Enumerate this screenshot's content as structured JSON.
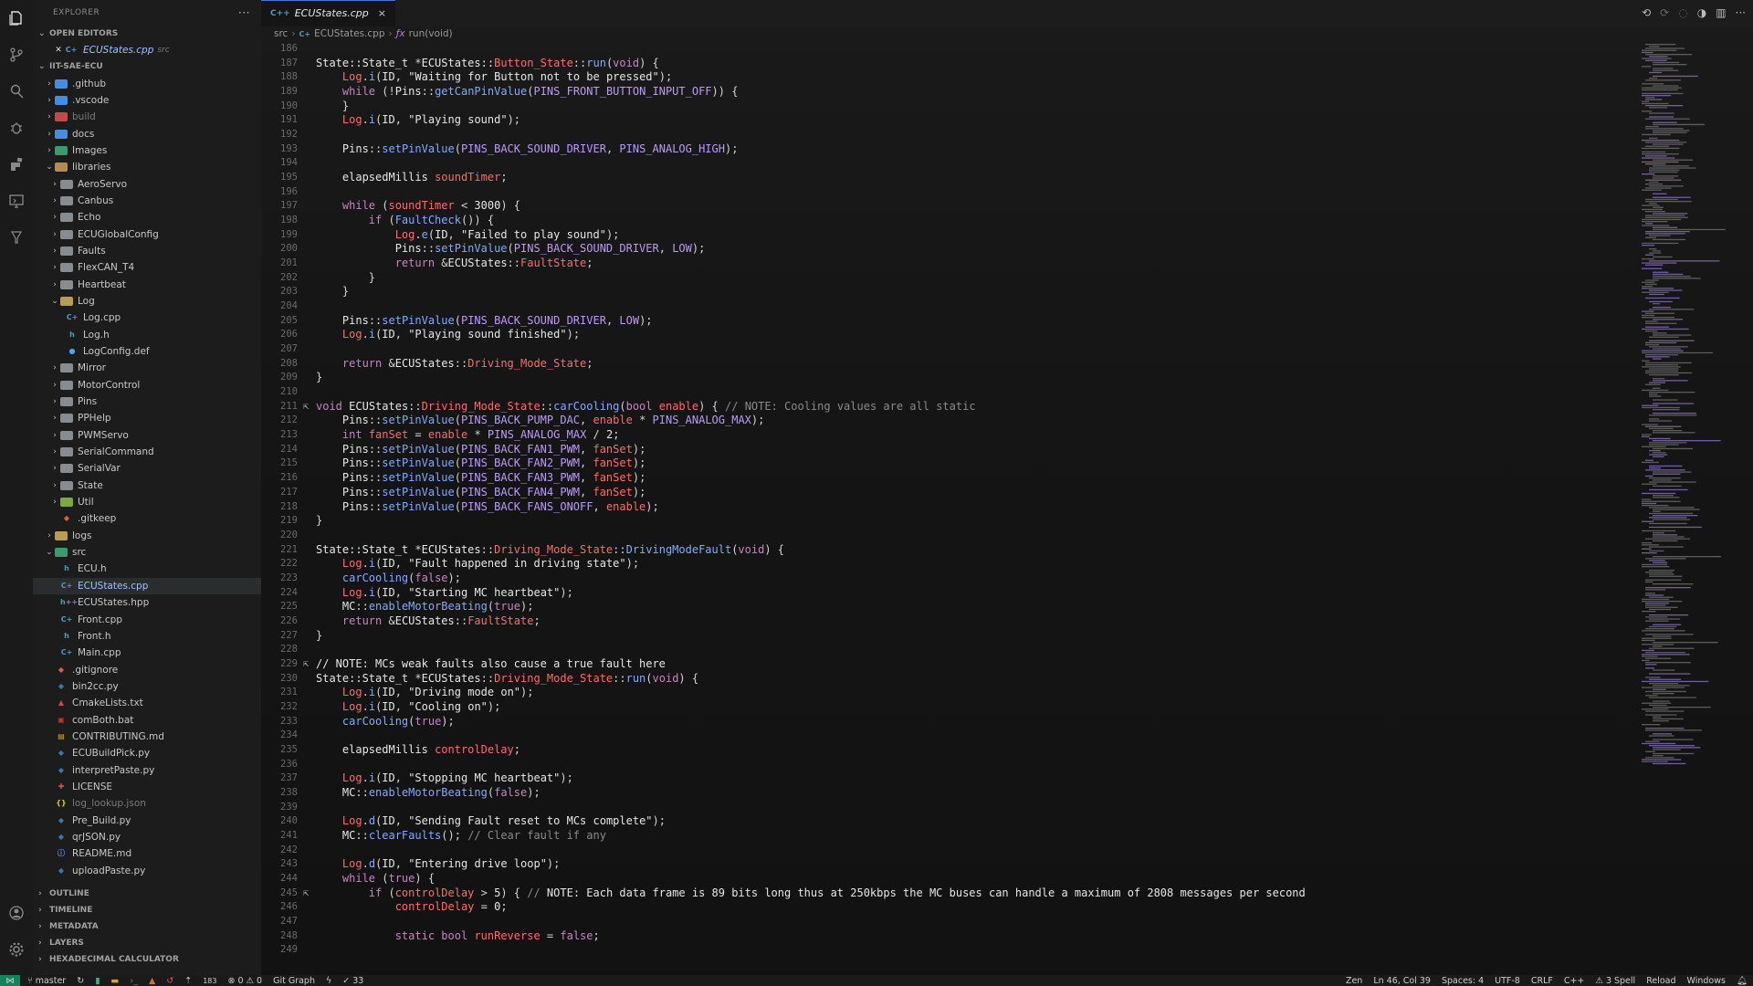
{
  "explorer": {
    "title": "EXPLORER",
    "more_label": "···",
    "open_editors_label": "OPEN EDITORS",
    "open_editor": {
      "name": "ECUStates.cpp",
      "path": "src"
    },
    "project_label": "IIT-SAE-ECU",
    "tree": [
      {
        "name": ".github",
        "depth": 0,
        "type": "folder",
        "color": "#4ea1ff"
      },
      {
        "name": ".vscode",
        "depth": 0,
        "type": "folder",
        "color": "#4ea1ff"
      },
      {
        "name": "build",
        "depth": 0,
        "type": "folder",
        "color": "#e05252",
        "dim": true
      },
      {
        "name": "docs",
        "depth": 0,
        "type": "folder",
        "color": "#4ea1ff"
      },
      {
        "name": "Images",
        "depth": 0,
        "type": "folder",
        "color": "#3fb27f"
      },
      {
        "name": "libraries",
        "depth": 0,
        "type": "folder-open",
        "color": "#c8a35a"
      },
      {
        "name": "AeroServo",
        "depth": 1,
        "type": "folder",
        "color": "#9aa0a6"
      },
      {
        "name": "Canbus",
        "depth": 1,
        "type": "folder",
        "color": "#9aa0a6"
      },
      {
        "name": "Echo",
        "depth": 1,
        "type": "folder",
        "color": "#9aa0a6"
      },
      {
        "name": "ECUGlobalConfig",
        "depth": 1,
        "type": "folder",
        "color": "#9aa0a6"
      },
      {
        "name": "Faults",
        "depth": 1,
        "type": "folder",
        "color": "#9aa0a6"
      },
      {
        "name": "FlexCAN_T4",
        "depth": 1,
        "type": "folder",
        "color": "#9aa0a6"
      },
      {
        "name": "Heartbeat",
        "depth": 1,
        "type": "folder",
        "color": "#9aa0a6"
      },
      {
        "name": "Log",
        "depth": 1,
        "type": "folder-open",
        "color": "#d4b35a"
      },
      {
        "name": "Log.cpp",
        "depth": 2,
        "type": "cpp",
        "color": "#519aba"
      },
      {
        "name": "Log.h",
        "depth": 2,
        "type": "h",
        "color": "#519aba"
      },
      {
        "name": "LogConfig.def",
        "depth": 2,
        "type": "def",
        "color": "#4ea1ff"
      },
      {
        "name": "Mirror",
        "depth": 1,
        "type": "folder",
        "color": "#9aa0a6"
      },
      {
        "name": "MotorControl",
        "depth": 1,
        "type": "folder",
        "color": "#9aa0a6"
      },
      {
        "name": "Pins",
        "depth": 1,
        "type": "folder",
        "color": "#9aa0a6"
      },
      {
        "name": "PPHelp",
        "depth": 1,
        "type": "folder",
        "color": "#9aa0a6"
      },
      {
        "name": "PWMServo",
        "depth": 1,
        "type": "folder",
        "color": "#9aa0a6"
      },
      {
        "name": "SerialCommand",
        "depth": 1,
        "type": "folder",
        "color": "#9aa0a6"
      },
      {
        "name": "SerialVar",
        "depth": 1,
        "type": "folder",
        "color": "#9aa0a6"
      },
      {
        "name": "State",
        "depth": 1,
        "type": "folder",
        "color": "#9aa0a6"
      },
      {
        "name": "Util",
        "depth": 1,
        "type": "folder",
        "color": "#8bc34a"
      },
      {
        "name": ".gitkeep",
        "depth": 1,
        "type": "git",
        "color": "#e0623a",
        "noarrow": true
      },
      {
        "name": "logs",
        "depth": 0,
        "type": "folder",
        "color": "#d4b35a"
      },
      {
        "name": "src",
        "depth": 0,
        "type": "folder-open",
        "color": "#3fb27f"
      },
      {
        "name": "ECU.h",
        "depth": 1,
        "type": "h",
        "color": "#519aba"
      },
      {
        "name": "ECUStates.cpp",
        "depth": 1,
        "type": "cpp",
        "color": "#519aba",
        "active": true
      },
      {
        "name": "ECUStates.hpp",
        "depth": 1,
        "type": "hpp",
        "color": "#519aba"
      },
      {
        "name": "Front.cpp",
        "depth": 1,
        "type": "cpp",
        "color": "#519aba"
      },
      {
        "name": "Front.h",
        "depth": 1,
        "type": "h",
        "color": "#519aba"
      },
      {
        "name": "Main.cpp",
        "depth": 1,
        "type": "cpp",
        "color": "#519aba"
      },
      {
        "name": ".gitignore",
        "depth": 0,
        "type": "git",
        "color": "#e0623a",
        "noarrow": true
      },
      {
        "name": "bin2cc.py",
        "depth": 0,
        "type": "py",
        "color": "#3b77b0",
        "noarrow": true
      },
      {
        "name": "CmakeLists.txt",
        "depth": 0,
        "type": "cmake",
        "color": "#c05050",
        "noarrow": true
      },
      {
        "name": "comBoth.bat",
        "depth": 0,
        "type": "bat",
        "color": "#c0392b",
        "noarrow": true
      },
      {
        "name": "CONTRIBUTING.md",
        "depth": 0,
        "type": "md",
        "color": "#e0b000",
        "noarrow": true
      },
      {
        "name": "ECUBuildPick.py",
        "depth": 0,
        "type": "py",
        "color": "#3b77b0",
        "noarrow": true
      },
      {
        "name": "interpretPaste.py",
        "depth": 0,
        "type": "py",
        "color": "#3b77b0",
        "noarrow": true
      },
      {
        "name": "LICENSE",
        "depth": 0,
        "type": "license",
        "color": "#e05252",
        "noarrow": true
      },
      {
        "name": "log_lookup.json",
        "depth": 0,
        "type": "json",
        "color": "#cbcb41",
        "noarrow": true,
        "dim": true
      },
      {
        "name": "Pre_Build.py",
        "depth": 0,
        "type": "py",
        "color": "#3b77b0",
        "noarrow": true
      },
      {
        "name": "qrJSON.py",
        "depth": 0,
        "type": "py",
        "color": "#3b77b0",
        "noarrow": true
      },
      {
        "name": "README.md",
        "depth": 0,
        "type": "info",
        "color": "#4ea1ff",
        "noarrow": true
      },
      {
        "name": "uploadPaste.py",
        "depth": 0,
        "type": "py",
        "color": "#3b77b0",
        "noarrow": true
      }
    ],
    "bottom_sections": [
      "OUTLINE",
      "TIMELINE",
      "METADATA",
      "LAYERS",
      "HEXADECIMAL CALCULATOR"
    ]
  },
  "tab": {
    "icon": "C++",
    "name": "ECUStates.cpp",
    "close": "×"
  },
  "breadcrumb": {
    "folder": "src",
    "file": "ECUStates.cpp",
    "symbol": "run(void)"
  },
  "code_lines": [
    {
      "n": "186",
      "h": ""
    },
    {
      "n": "187",
      "h": "<span class='t'>State::State_t</span> *<span class='t'>ECUStates::</span><span class='v'>Button_State</span>::<span class='f'>run</span>(<span class='k'>void</span>) {"
    },
    {
      "n": "188",
      "h": "    <span class='v'>Log</span>.<span class='f'>i</span>(<span class='n'>ID</span>, <span class='s'>\"Waiting for Button not to be pressed\"</span>);"
    },
    {
      "n": "189",
      "h": "    <span class='k'>while</span> (!<span class='t'>Pins</span>::<span class='f'>getCanPinValue</span>(<span class='m'>PINS_FRONT_BUTTON_INPUT_OFF</span>)) {"
    },
    {
      "n": "190",
      "h": "    }"
    },
    {
      "n": "191",
      "h": "    <span class='v'>Log</span>.<span class='f'>i</span>(<span class='n'>ID</span>, <span class='s'>\"Playing sound\"</span>);"
    },
    {
      "n": "192",
      "h": ""
    },
    {
      "n": "193",
      "h": "    <span class='t'>Pins</span>::<span class='f'>setPinValue</span>(<span class='m'>PINS_BACK_SOUND_DRIVER</span>, <span class='m'>PINS_ANALOG_HIGH</span>);"
    },
    {
      "n": "194",
      "h": ""
    },
    {
      "n": "195",
      "h": "    <span class='t'>elapsedMillis</span> <span class='v'>soundTimer</span>;"
    },
    {
      "n": "196",
      "h": ""
    },
    {
      "n": "197",
      "h": "    <span class='k'>while</span> (<span class='v'>soundTimer</span> &lt; <span class='n'>3000</span>) {"
    },
    {
      "n": "198",
      "h": "        <span class='k'>if</span> (<span class='f'>FaultCheck</span>()) {"
    },
    {
      "n": "199",
      "h": "            <span class='v'>Log</span>.<span class='f'>e</span>(<span class='n'>ID</span>, <span class='s'>\"Failed to play sound\"</span>);"
    },
    {
      "n": "200",
      "h": "            <span class='t'>Pins</span>::<span class='f'>setPinValue</span>(<span class='m'>PINS_BACK_SOUND_DRIVER</span>, <span class='m'>LOW</span>);"
    },
    {
      "n": "201",
      "h": "            <span class='k'>return</span> &amp;<span class='t'>ECUStates</span>::<span class='v'>FaultState</span>;"
    },
    {
      "n": "202",
      "h": "        }"
    },
    {
      "n": "203",
      "h": "    }"
    },
    {
      "n": "204",
      "h": ""
    },
    {
      "n": "205",
      "h": "    <span class='t'>Pins</span>::<span class='f'>setPinValue</span>(<span class='m'>PINS_BACK_SOUND_DRIVER</span>, <span class='m'>LOW</span>);"
    },
    {
      "n": "206",
      "h": "    <span class='v'>Log</span>.<span class='f'>i</span>(<span class='n'>ID</span>, <span class='s'>\"Playing sound finished\"</span>);"
    },
    {
      "n": "207",
      "h": ""
    },
    {
      "n": "208",
      "h": "    <span class='k'>return</span> &amp;<span class='t'>ECUStates</span>::<span class='v'>Driving_Mode_State</span>;"
    },
    {
      "n": "209",
      "h": "}"
    },
    {
      "n": "210",
      "h": ""
    },
    {
      "n": "211",
      "h": "<span class='k'>void</span> <span class='t'>ECUStates</span>::<span class='v'>Driving_Mode_State</span>::<span class='f'>carCooling</span>(<span class='k'>bool</span> <span class='v'>enable</span>) { <span class='c'>// NOTE: Cooling values are all static</span>",
      "g": "⇱"
    },
    {
      "n": "212",
      "h": "    <span class='t'>Pins</span>::<span class='f'>setPinValue</span>(<span class='m'>PINS_BACK_PUMP_DAC</span>, <span class='v'>enable</span> * <span class='m'>PINS_ANALOG_MAX</span>);"
    },
    {
      "n": "213",
      "h": "    <span class='k'>int</span> <span class='v'>fanSet</span> = <span class='v'>enable</span> * <span class='m'>PINS_ANALOG_MAX</span> / <span class='n'>2</span>;"
    },
    {
      "n": "214",
      "h": "    <span class='t'>Pins</span>::<span class='f'>setPinValue</span>(<span class='m'>PINS_BACK_FAN1_PWM</span>, <span class='v'>fanSet</span>);"
    },
    {
      "n": "215",
      "h": "    <span class='t'>Pins</span>::<span class='f'>setPinValue</span>(<span class='m'>PINS_BACK_FAN2_PWM</span>, <span class='v'>fanSet</span>);"
    },
    {
      "n": "216",
      "h": "    <span class='t'>Pins</span>::<span class='f'>setPinValue</span>(<span class='m'>PINS_BACK_FAN3_PWM</span>, <span class='v'>fanSet</span>);"
    },
    {
      "n": "217",
      "h": "    <span class='t'>Pins</span>::<span class='f'>setPinValue</span>(<span class='m'>PINS_BACK_FAN4_PWM</span>, <span class='v'>fanSet</span>);"
    },
    {
      "n": "218",
      "h": "    <span class='t'>Pins</span>::<span class='f'>setPinValue</span>(<span class='m'>PINS_BACK_FANS_ONOFF</span>, <span class='v'>enable</span>);"
    },
    {
      "n": "219",
      "h": "}"
    },
    {
      "n": "220",
      "h": ""
    },
    {
      "n": "221",
      "h": "<span class='t'>State::State_t</span> *<span class='t'>ECUStates</span>::<span class='v'>Driving_Mode_State</span>::<span class='f'>DrivingModeFault</span>(<span class='k'>void</span>) {"
    },
    {
      "n": "222",
      "h": "    <span class='v'>Log</span>.<span class='f'>i</span>(<span class='n'>ID</span>, <span class='s'>\"Fault happened in driving state\"</span>);"
    },
    {
      "n": "223",
      "h": "    <span class='f'>carCooling</span>(<span class='k'>false</span>);"
    },
    {
      "n": "224",
      "h": "    <span class='v'>Log</span>.<span class='f'>i</span>(<span class='n'>ID</span>, <span class='s'>\"Starting MC heartbeat\"</span>);"
    },
    {
      "n": "225",
      "h": "    <span class='t'>MC</span>::<span class='f'>enableMotorBeating</span>(<span class='k'>true</span>);"
    },
    {
      "n": "226",
      "h": "    <span class='k'>return</span> &amp;<span class='t'>ECUStates</span>::<span class='v'>FaultState</span>;"
    },
    {
      "n": "227",
      "h": "}"
    },
    {
      "n": "228",
      "h": ""
    },
    {
      "n": "229",
      "h": "<span class='n'>// NOTE: MCs weak faults also cause a true fault here</span>",
      "g": "⇱"
    },
    {
      "n": "230",
      "h": "<span class='t'>State::State_t</span> *<span class='t'>ECUStates</span>::<span class='v'>Driving_Mode_State</span>::<span class='f'>run</span>(<span class='k'>void</span>) {"
    },
    {
      "n": "231",
      "h": "    <span class='v'>Log</span>.<span class='f'>i</span>(<span class='n'>ID</span>, <span class='s'>\"Driving mode on\"</span>);"
    },
    {
      "n": "232",
      "h": "    <span class='v'>Log</span>.<span class='f'>i</span>(<span class='n'>ID</span>, <span class='s'>\"Cooling on\"</span>);"
    },
    {
      "n": "233",
      "h": "    <span class='f'>carCooling</span>(<span class='k'>true</span>);"
    },
    {
      "n": "234",
      "h": ""
    },
    {
      "n": "235",
      "h": "    <span class='t'>elapsedMillis</span> <span class='v'>controlDelay</span>;"
    },
    {
      "n": "236",
      "h": ""
    },
    {
      "n": "237",
      "h": "    <span class='v'>Log</span>.<span class='f'>i</span>(<span class='n'>ID</span>, <span class='s'>\"Stopping MC heartbeat\"</span>);"
    },
    {
      "n": "238",
      "h": "    <span class='t'>MC</span>::<span class='f'>enableMotorBeating</span>(<span class='k'>false</span>);"
    },
    {
      "n": "239",
      "h": ""
    },
    {
      "n": "240",
      "h": "    <span class='v'>Log</span>.<span class='f'>d</span>(<span class='n'>ID</span>, <span class='s'>\"Sending Fault reset to MCs complete\"</span>);"
    },
    {
      "n": "241",
      "h": "    <span class='t'>MC</span>::<span class='f'>clearFaults</span>(); <span class='c'>// Clear fault if any</span>"
    },
    {
      "n": "242",
      "h": ""
    },
    {
      "n": "243",
      "h": "    <span class='v'>Log</span>.<span class='f'>d</span>(<span class='n'>ID</span>, <span class='s'>\"Entering drive loop\"</span>);"
    },
    {
      "n": "244",
      "h": "    <span class='k'>while</span> (<span class='k'>true</span>) {"
    },
    {
      "n": "245",
      "h": "        <span class='k'>if</span> (<span class='v'>controlDelay</span> &gt; <span class='n'>5</span>) { <span class='c'>// </span><span class='n'>NOTE: Each data frame is 89 bits long thus at 250kbps the MC buses can handle a maximum of 2808 messages per second</span>",
      "g": "⇱"
    },
    {
      "n": "246",
      "h": "            <span class='v'>controlDelay</span> = <span class='n'>0</span>;"
    },
    {
      "n": "247",
      "h": ""
    },
    {
      "n": "248",
      "h": "            <span class='k'>static</span> <span class='k'>bool</span> <span class='v'>runReverse</span> = <span class='k'>false</span>;"
    },
    {
      "n": "249",
      "h": ""
    }
  ],
  "statusbar": {
    "branch": "master",
    "badge_num": "183",
    "errors": "0",
    "warnings": "0",
    "git_graph": "Git Graph",
    "checks": "33",
    "zen": "Zen",
    "cursor": "Ln 46, Col 39",
    "spaces": "Spaces: 4",
    "encoding": "UTF-8",
    "eol": "CRLF",
    "language": "C++",
    "spell": "3 Spell",
    "reload": "Reload",
    "platform": "Windows"
  },
  "colors": {
    "accent": "#3c78d8",
    "remote": "#16825d"
  }
}
